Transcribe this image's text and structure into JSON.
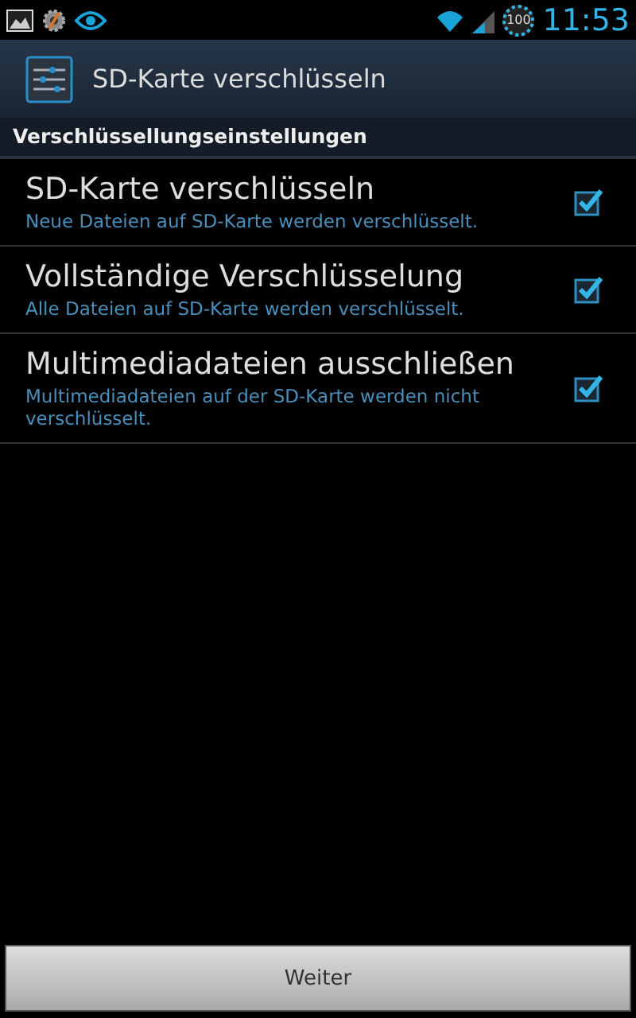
{
  "status_bar": {
    "battery": "100",
    "time": "11:53"
  },
  "action_bar": {
    "title": "SD-Karte verschlüsseln"
  },
  "section": {
    "title": "Verschlüssellungseinstellungen"
  },
  "settings": [
    {
      "title": "SD-Karte verschlüsseln",
      "summary": "Neue Dateien auf SD-Karte werden verschlüsselt.",
      "checked": true
    },
    {
      "title": "Vollständige Verschlüsselung",
      "summary": "Alle Dateien auf SD-Karte werden verschlüsselt.",
      "checked": true
    },
    {
      "title": "Multimediadateien ausschließen",
      "summary": "Multimediadateien auf der SD-Karte werden nicht verschlüsselt.",
      "checked": true
    }
  ],
  "button": {
    "label": "Weiter"
  }
}
